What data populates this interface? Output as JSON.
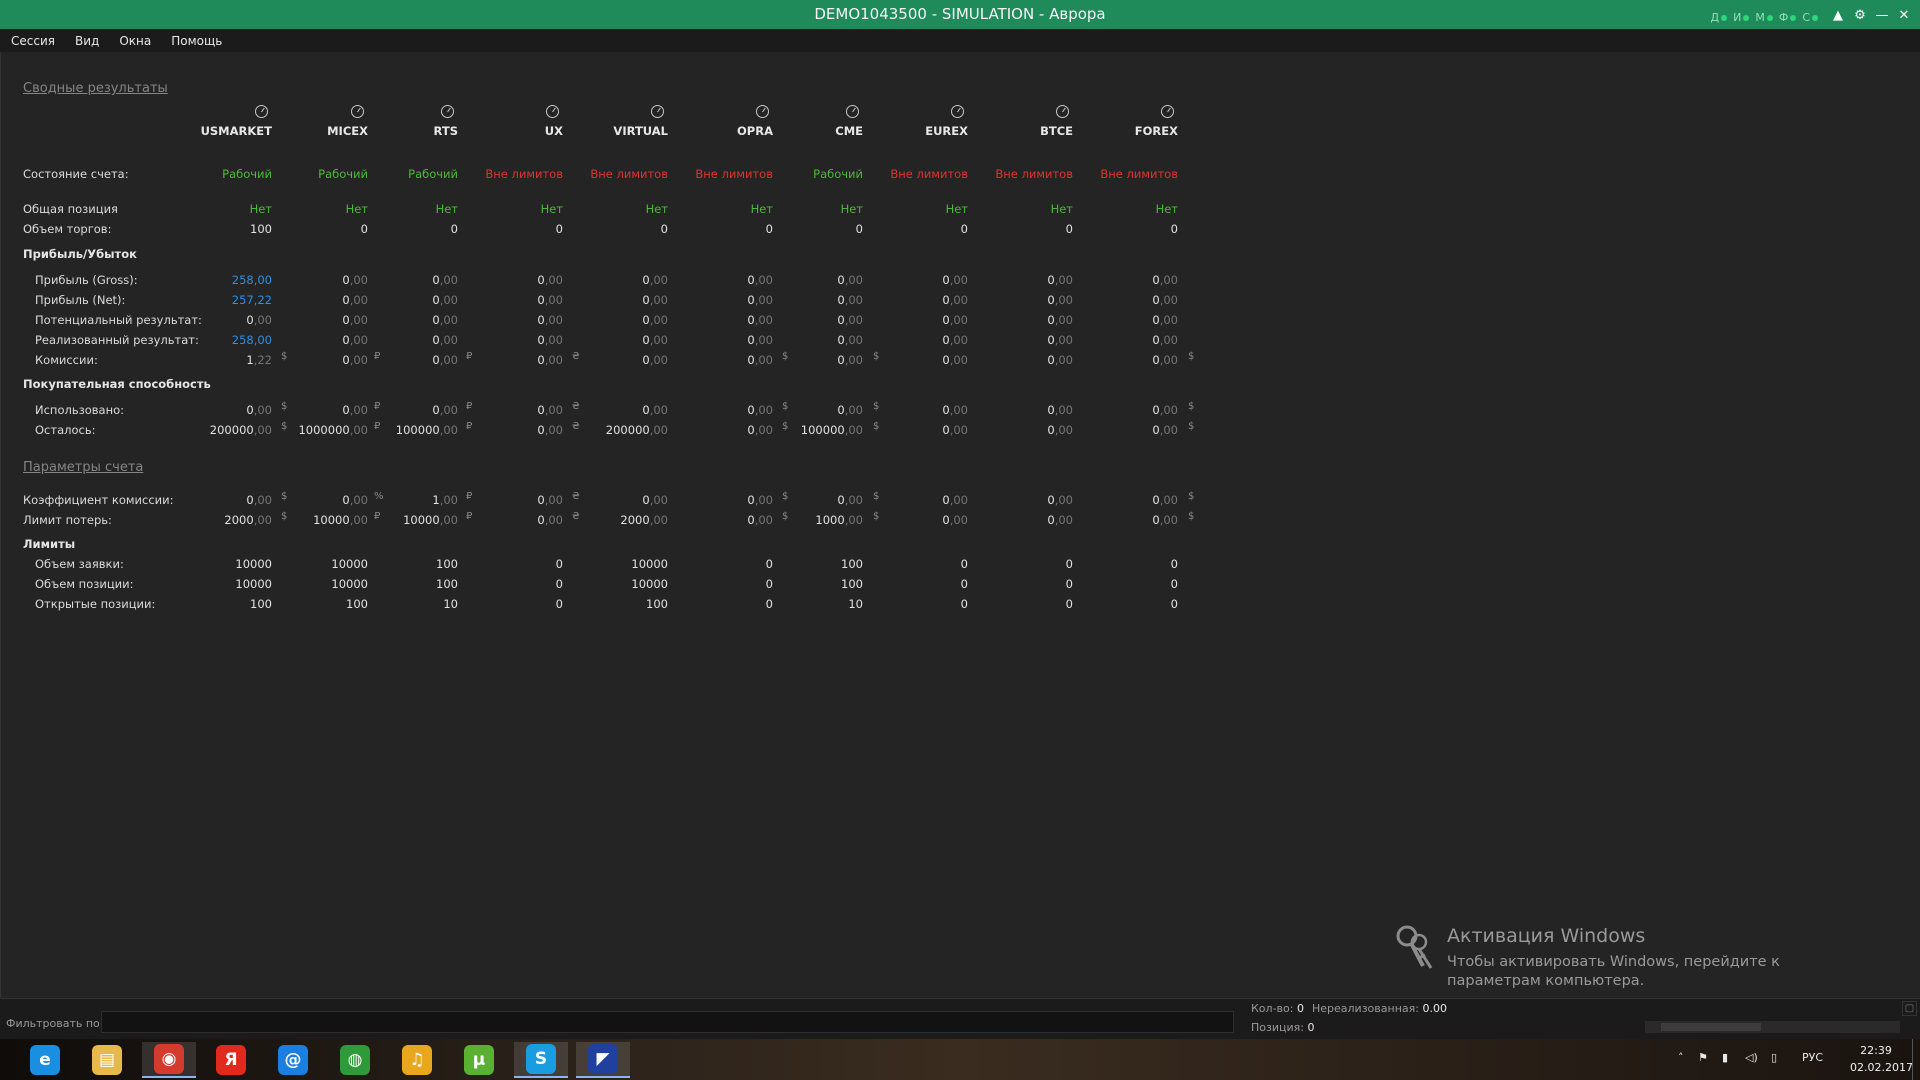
{
  "window": {
    "title": "DEMO1043500 - SIMULATION - Аврора",
    "status_indicators": [
      "Д",
      "И",
      "М",
      "Ф",
      "С"
    ]
  },
  "menu": [
    "Сессия",
    "Вид",
    "Окна",
    "Помощь"
  ],
  "sections": {
    "summary_link": "Сводные результаты",
    "pnl_title": "Прибыль/Убыток",
    "buying_power_title": "Покупательная способность",
    "account_params_link": "Параметры счета",
    "limits_title": "Лимиты"
  },
  "columns": [
    "USMARKET",
    "MICEX",
    "RTS",
    "UX",
    "VIRTUAL",
    "OPRA",
    "CME",
    "EUREX",
    "BTCE",
    "FOREX"
  ],
  "rows": {
    "account_state": {
      "label": "Состояние счета:",
      "cells": [
        {
          "t": "Рабочий",
          "c": "green"
        },
        {
          "t": "Рабочий",
          "c": "green"
        },
        {
          "t": "Рабочий",
          "c": "green"
        },
        {
          "t": "Вне лимитов",
          "c": "red"
        },
        {
          "t": "Вне лимитов",
          "c": "red"
        },
        {
          "t": "Вне лимитов",
          "c": "red"
        },
        {
          "t": "Рабочий",
          "c": "green"
        },
        {
          "t": "Вне лимитов",
          "c": "red"
        },
        {
          "t": "Вне лимитов",
          "c": "red"
        },
        {
          "t": "Вне лимитов",
          "c": "red"
        }
      ]
    },
    "total_position": {
      "label": "Общая позиция",
      "cells": [
        {
          "t": "Нет",
          "c": "green"
        },
        {
          "t": "Нет",
          "c": "green"
        },
        {
          "t": "Нет",
          "c": "green"
        },
        {
          "t": "Нет",
          "c": "green"
        },
        {
          "t": "Нет",
          "c": "green"
        },
        {
          "t": "Нет",
          "c": "green"
        },
        {
          "t": "Нет",
          "c": "green"
        },
        {
          "t": "Нет",
          "c": "green"
        },
        {
          "t": "Нет",
          "c": "green"
        },
        {
          "t": "Нет",
          "c": "green"
        }
      ]
    },
    "trade_volume": {
      "label": "Объем торгов:",
      "cells": [
        {
          "t": "100"
        },
        {
          "t": "0"
        },
        {
          "t": "0"
        },
        {
          "t": "0"
        },
        {
          "t": "0"
        },
        {
          "t": "0"
        },
        {
          "t": "0"
        },
        {
          "t": "0"
        },
        {
          "t": "0"
        },
        {
          "t": "0"
        }
      ]
    },
    "profit_gross": {
      "label": "Прибыль (Gross):",
      "cells": [
        {
          "i": "258",
          "d": ",00",
          "c": "blue"
        },
        {
          "i": "0",
          "d": ",00"
        },
        {
          "i": "0",
          "d": ",00"
        },
        {
          "i": "0",
          "d": ",00"
        },
        {
          "i": "0",
          "d": ",00"
        },
        {
          "i": "0",
          "d": ",00"
        },
        {
          "i": "0",
          "d": ",00"
        },
        {
          "i": "0",
          "d": ",00"
        },
        {
          "i": "0",
          "d": ",00"
        },
        {
          "i": "0",
          "d": ",00"
        }
      ]
    },
    "profit_net": {
      "label": "Прибыль (Net):",
      "cells": [
        {
          "i": "257",
          "d": ",22",
          "c": "blue"
        },
        {
          "i": "0",
          "d": ",00"
        },
        {
          "i": "0",
          "d": ",00"
        },
        {
          "i": "0",
          "d": ",00"
        },
        {
          "i": "0",
          "d": ",00"
        },
        {
          "i": "0",
          "d": ",00"
        },
        {
          "i": "0",
          "d": ",00"
        },
        {
          "i": "0",
          "d": ",00"
        },
        {
          "i": "0",
          "d": ",00"
        },
        {
          "i": "0",
          "d": ",00"
        }
      ]
    },
    "potential_result": {
      "label": "Потенциальный результат:",
      "cells": [
        {
          "i": "0",
          "d": ",00"
        },
        {
          "i": "0",
          "d": ",00"
        },
        {
          "i": "0",
          "d": ",00"
        },
        {
          "i": "0",
          "d": ",00"
        },
        {
          "i": "0",
          "d": ",00"
        },
        {
          "i": "0",
          "d": ",00"
        },
        {
          "i": "0",
          "d": ",00"
        },
        {
          "i": "0",
          "d": ",00"
        },
        {
          "i": "0",
          "d": ",00"
        },
        {
          "i": "0",
          "d": ",00"
        }
      ]
    },
    "realized_result": {
      "label": "Реализованный результат:",
      "cells": [
        {
          "i": "258",
          "d": ",00",
          "c": "blue"
        },
        {
          "i": "0",
          "d": ",00"
        },
        {
          "i": "0",
          "d": ",00"
        },
        {
          "i": "0",
          "d": ",00"
        },
        {
          "i": "0",
          "d": ",00"
        },
        {
          "i": "0",
          "d": ",00"
        },
        {
          "i": "0",
          "d": ",00"
        },
        {
          "i": "0",
          "d": ",00"
        },
        {
          "i": "0",
          "d": ",00"
        },
        {
          "i": "0",
          "d": ",00"
        }
      ]
    },
    "commissions": {
      "label": "Комиссии:",
      "cells": [
        {
          "i": "1",
          "d": ",22",
          "u": "$"
        },
        {
          "i": "0",
          "d": ",00",
          "u": "₽"
        },
        {
          "i": "0",
          "d": ",00",
          "u": "₽"
        },
        {
          "i": "0",
          "d": ",00",
          "u": "₴"
        },
        {
          "i": "0",
          "d": ",00"
        },
        {
          "i": "0",
          "d": ",00",
          "u": "$"
        },
        {
          "i": "0",
          "d": ",00",
          "u": "$"
        },
        {
          "i": "0",
          "d": ",00"
        },
        {
          "i": "0",
          "d": ",00"
        },
        {
          "i": "0",
          "d": ",00",
          "u": "$"
        }
      ]
    },
    "used": {
      "label": "Использовано:",
      "cells": [
        {
          "i": "0",
          "d": ",00",
          "u": "$"
        },
        {
          "i": "0",
          "d": ",00",
          "u": "₽"
        },
        {
          "i": "0",
          "d": ",00",
          "u": "₽"
        },
        {
          "i": "0",
          "d": ",00",
          "u": "₴"
        },
        {
          "i": "0",
          "d": ",00"
        },
        {
          "i": "0",
          "d": ",00",
          "u": "$"
        },
        {
          "i": "0",
          "d": ",00",
          "u": "$"
        },
        {
          "i": "0",
          "d": ",00"
        },
        {
          "i": "0",
          "d": ",00"
        },
        {
          "i": "0",
          "d": ",00",
          "u": "$"
        }
      ]
    },
    "remaining": {
      "label": "Осталось:",
      "cells": [
        {
          "i": "200000",
          "d": ",00",
          "u": "$"
        },
        {
          "i": "1000000",
          "d": ",00",
          "u": "₽"
        },
        {
          "i": "100000",
          "d": ",00",
          "u": "₽"
        },
        {
          "i": "0",
          "d": ",00",
          "u": "₴"
        },
        {
          "i": "200000",
          "d": ",00"
        },
        {
          "i": "0",
          "d": ",00",
          "u": "$"
        },
        {
          "i": "100000",
          "d": ",00",
          "u": "$"
        },
        {
          "i": "0",
          "d": ",00"
        },
        {
          "i": "0",
          "d": ",00"
        },
        {
          "i": "0",
          "d": ",00",
          "u": "$"
        }
      ]
    },
    "commission_coef": {
      "label": "Коэффициент комиссии:",
      "cells": [
        {
          "i": "0",
          "d": ",00",
          "u": "$"
        },
        {
          "i": "0",
          "d": ",00",
          "u": "%"
        },
        {
          "i": "1",
          "d": ",00",
          "u": "₽"
        },
        {
          "i": "0",
          "d": ",00",
          "u": "₴"
        },
        {
          "i": "0",
          "d": ",00"
        },
        {
          "i": "0",
          "d": ",00",
          "u": "$"
        },
        {
          "i": "0",
          "d": ",00",
          "u": "$"
        },
        {
          "i": "0",
          "d": ",00"
        },
        {
          "i": "0",
          "d": ",00"
        },
        {
          "i": "0",
          "d": ",00",
          "u": "$"
        }
      ]
    },
    "loss_limit": {
      "label": "Лимит потерь:",
      "cells": [
        {
          "i": "2000",
          "d": ",00",
          "u": "$"
        },
        {
          "i": "10000",
          "d": ",00",
          "u": "₽"
        },
        {
          "i": "10000",
          "d": ",00",
          "u": "₽"
        },
        {
          "i": "0",
          "d": ",00",
          "u": "₴"
        },
        {
          "i": "2000",
          "d": ",00"
        },
        {
          "i": "0",
          "d": ",00",
          "u": "$"
        },
        {
          "i": "1000",
          "d": ",00",
          "u": "$"
        },
        {
          "i": "0",
          "d": ",00"
        },
        {
          "i": "0",
          "d": ",00"
        },
        {
          "i": "0",
          "d": ",00",
          "u": "$"
        }
      ]
    },
    "order_volume": {
      "label": "Объем заявки:",
      "cells": [
        {
          "t": "10000"
        },
        {
          "t": "10000"
        },
        {
          "t": "100"
        },
        {
          "t": "0"
        },
        {
          "t": "10000"
        },
        {
          "t": "0"
        },
        {
          "t": "100"
        },
        {
          "t": "0"
        },
        {
          "t": "0"
        },
        {
          "t": "0"
        }
      ]
    },
    "position_volume": {
      "label": "Объем позиции:",
      "cells": [
        {
          "t": "10000"
        },
        {
          "t": "10000"
        },
        {
          "t": "100"
        },
        {
          "t": "0"
        },
        {
          "t": "10000"
        },
        {
          "t": "0"
        },
        {
          "t": "100"
        },
        {
          "t": "0"
        },
        {
          "t": "0"
        },
        {
          "t": "0"
        }
      ]
    },
    "open_positions": {
      "label": "Открытые позиции:",
      "cells": [
        {
          "t": "100"
        },
        {
          "t": "100"
        },
        {
          "t": "10"
        },
        {
          "t": "0"
        },
        {
          "t": "100"
        },
        {
          "t": "0"
        },
        {
          "t": "10"
        },
        {
          "t": "0"
        },
        {
          "t": "0"
        },
        {
          "t": "0"
        }
      ]
    }
  },
  "activation": {
    "title": "Активация Windows",
    "text": "Чтобы активировать Windows, перейдите к параметрам компьютера."
  },
  "bottom": {
    "filter_label": "Фильтровать по",
    "filter_value": "",
    "qty_label": "Кол-во:",
    "qty_value": "0",
    "unrealized_label": "Нереализованная:",
    "unrealized_value": "0.00",
    "position_label": "Позиция:",
    "position_value": "0"
  },
  "taskbar": {
    "apps": [
      {
        "name": "ie",
        "glyph": "e",
        "color": "#1a8ee0"
      },
      {
        "name": "explorer",
        "glyph": "▤",
        "color": "#e6b94a"
      },
      {
        "name": "chrome",
        "glyph": "◉",
        "color": "#d33b2c"
      },
      {
        "name": "yandex",
        "glyph": "Я",
        "color": "#e02a1e"
      },
      {
        "name": "mail",
        "glyph": "@",
        "color": "#1a7fe0"
      },
      {
        "name": "globe",
        "glyph": "◍",
        "color": "#2e9a3a"
      },
      {
        "name": "music",
        "glyph": "♫",
        "color": "#e8a71d"
      },
      {
        "name": "utorrent",
        "glyph": "μ",
        "color": "#5ab030"
      },
      {
        "name": "skype",
        "glyph": "S",
        "color": "#1a9de0"
      },
      {
        "name": "aurora",
        "glyph": "◤",
        "color": "#2040a0"
      }
    ],
    "tray_lang": "РУС",
    "time": "22:39",
    "date": "02.02.2017"
  }
}
